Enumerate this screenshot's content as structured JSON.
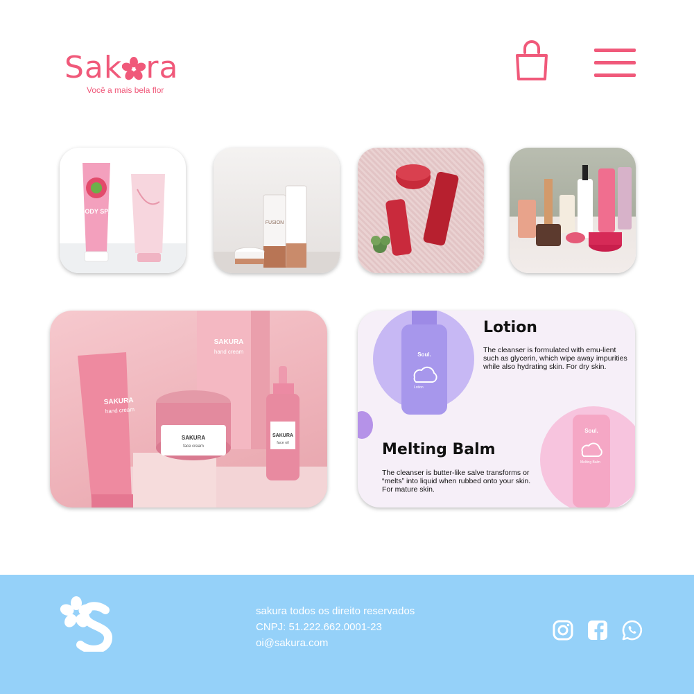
{
  "brand": {
    "name_left": "Sak",
    "name_right": "ra",
    "tagline": "Você a mais bela flor",
    "accent": "#f0597a"
  },
  "header": {
    "icons": [
      "shopping-bag-icon",
      "hamburger-menu-icon"
    ]
  },
  "products": {
    "card1": {
      "label": "SAKURA",
      "tube_subtitle": "hand cream",
      "jar_subtitle": "face cream",
      "bottle_subtitle": "face oil",
      "box_subtitle": "hand cream"
    },
    "card2": {
      "lotion_title": "Lotion",
      "lotion_text": "The cleanser is formulated with emu-lient such as glycerin, which wipe away impurities while also hydrating skin. For dry skin.",
      "balm_title": "Melting Balm",
      "balm_text": "The cleanser is butter-like salve transforms or “melts” into liquid when rubbed onto your skin. For mature skin.",
      "bottle_brand": "Soul.",
      "bottle_label": "Lotion",
      "tube_brand": "Soul.",
      "tube_label": "Melting Balm"
    },
    "thumb1": {
      "label": "BODY SPA"
    },
    "thumb2": {
      "label": "FUSION"
    }
  },
  "footer": {
    "line1": "sakura  todos os direito reservados",
    "line2": "CNPJ: 51.222.662.0001-23",
    "line3": "oi@sakura.com",
    "background": "#95d1f9",
    "social": [
      "instagram-icon",
      "facebook-icon",
      "whatsapp-icon"
    ]
  }
}
